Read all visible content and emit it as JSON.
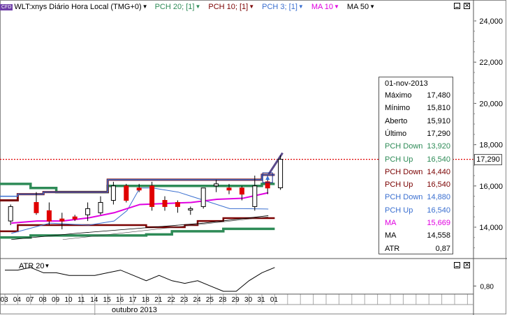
{
  "header": {
    "badge": "CFD",
    "legend": [
      {
        "label": "WLT:xnys Diário Hora Local (TMG+0)",
        "color": "#000000"
      },
      {
        "label": "PCH 20; [1]",
        "color": "#2e8b57"
      },
      {
        "label": "PCH 10; [1]",
        "color": "#7a0000"
      },
      {
        "label": "PCH 3; [1]",
        "color": "#3a6fd0"
      },
      {
        "label": "MA 10",
        "color": "#e000e0"
      },
      {
        "label": "MA 50",
        "color": "#000000"
      }
    ]
  },
  "price_axis": {
    "ticks": [
      "24,000",
      "22,000",
      "20,000",
      "18,000",
      "16,000",
      "14,000"
    ],
    "current_price": "17,290"
  },
  "info_box": {
    "date": "01-nov-2013",
    "rows": [
      {
        "label": "Máximo",
        "value": "17,480",
        "color": "#000000"
      },
      {
        "label": "Mínimo",
        "value": "15,810",
        "color": "#000000"
      },
      {
        "label": "Aberto",
        "value": "15,910",
        "color": "#000000"
      },
      {
        "label": "Último",
        "value": "17,290",
        "color": "#000000"
      },
      {
        "label": "PCH Down",
        "value": "13,920",
        "color": "#2e8b57"
      },
      {
        "label": "PCH Up",
        "value": "16,540",
        "color": "#2e8b57"
      },
      {
        "label": "PCH Down",
        "value": "14,440",
        "color": "#7a0000"
      },
      {
        "label": "PCH Up",
        "value": "16,540",
        "color": "#7a0000"
      },
      {
        "label": "PCH Down",
        "value": "14,880",
        "color": "#3a6fd0"
      },
      {
        "label": "PCH Up",
        "value": "16,540",
        "color": "#3a6fd0"
      },
      {
        "label": "MA",
        "value": "15,669",
        "color": "#e000e0"
      },
      {
        "label": "MA",
        "value": "14,558",
        "color": "#000000"
      },
      {
        "label": "ATR",
        "value": "0,87",
        "color": "#000000"
      }
    ]
  },
  "atr_panel": {
    "label": "ATR 20",
    "tick": "0,80"
  },
  "x_axis": {
    "days": [
      "03",
      "04",
      "07",
      "08",
      "09",
      "10",
      "11",
      "14",
      "15",
      "16",
      "17",
      "18",
      "21",
      "22",
      "23",
      "24",
      "25",
      "28",
      "29",
      "30",
      "31",
      "01"
    ],
    "month": "outubro 2013"
  },
  "colors": {
    "pch20": "#2e8b57",
    "pch10": "#7a0000",
    "pch3": "#3a6fd0",
    "ma10": "#e000e0",
    "ma50": "#000000",
    "bear": "#e00000",
    "bull": "#ffffff",
    "price_line": "#e00000"
  },
  "chart_data": {
    "type": "candlestick",
    "price_ticks": [
      24,
      22,
      20,
      18,
      16,
      14
    ],
    "candles": [
      {
        "d": "03",
        "o": 14.3,
        "h": 15.1,
        "l": 14.1,
        "c": 15.0
      },
      {
        "d": "07",
        "o": 15.2,
        "h": 15.7,
        "l": 14.6,
        "c": 14.7
      },
      {
        "d": "08",
        "o": 14.8,
        "h": 15.2,
        "l": 14.1,
        "c": 14.3
      },
      {
        "d": "09",
        "o": 14.4,
        "h": 14.7,
        "l": 13.9,
        "c": 14.3
      },
      {
        "d": "10",
        "o": 14.5,
        "h": 14.6,
        "l": 14.3,
        "c": 14.4
      },
      {
        "d": "11",
        "o": 14.6,
        "h": 15.2,
        "l": 14.3,
        "c": 14.9
      },
      {
        "d": "14",
        "o": 14.7,
        "h": 15.5,
        "l": 14.6,
        "c": 15.2
      },
      {
        "d": "15",
        "o": 15.3,
        "h": 16.2,
        "l": 15.1,
        "c": 16.0
      },
      {
        "d": "16",
        "o": 16.0,
        "h": 16.1,
        "l": 15.2,
        "c": 15.3
      },
      {
        "d": "17",
        "o": 15.9,
        "h": 16.1,
        "l": 15.7,
        "c": 15.8
      },
      {
        "d": "18",
        "o": 16.0,
        "h": 16.2,
        "l": 14.8,
        "c": 15.0
      },
      {
        "d": "21",
        "o": 15.3,
        "h": 15.5,
        "l": 14.8,
        "c": 15.0
      },
      {
        "d": "22",
        "o": 15.2,
        "h": 15.3,
        "l": 14.7,
        "c": 15.0
      },
      {
        "d": "23",
        "o": 14.9,
        "h": 15.0,
        "l": 14.6,
        "c": 14.9
      },
      {
        "d": "24",
        "o": 15.0,
        "h": 15.9,
        "l": 14.9,
        "c": 15.9
      },
      {
        "d": "25",
        "o": 16.0,
        "h": 16.3,
        "l": 15.7,
        "c": 16.1
      },
      {
        "d": "28",
        "o": 15.9,
        "h": 16.1,
        "l": 15.6,
        "c": 15.8
      },
      {
        "d": "29",
        "o": 15.9,
        "h": 16.0,
        "l": 15.3,
        "c": 15.6
      },
      {
        "d": "30",
        "o": 15.0,
        "h": 16.5,
        "l": 14.8,
        "c": 16.0
      },
      {
        "d": "31",
        "o": 16.2,
        "h": 16.5,
        "l": 15.6,
        "c": 15.9
      },
      {
        "d": "01",
        "o": 15.91,
        "h": 17.48,
        "l": 15.81,
        "c": 17.29
      }
    ],
    "atr_values": [
      0.86,
      0.86,
      0.87,
      0.85,
      0.85,
      0.84,
      0.84,
      0.84,
      0.85,
      0.86,
      0.84,
      0.82,
      0.84,
      0.82,
      0.81,
      0.82,
      0.8,
      0.78,
      0.78,
      0.82,
      0.85,
      0.87
    ]
  }
}
